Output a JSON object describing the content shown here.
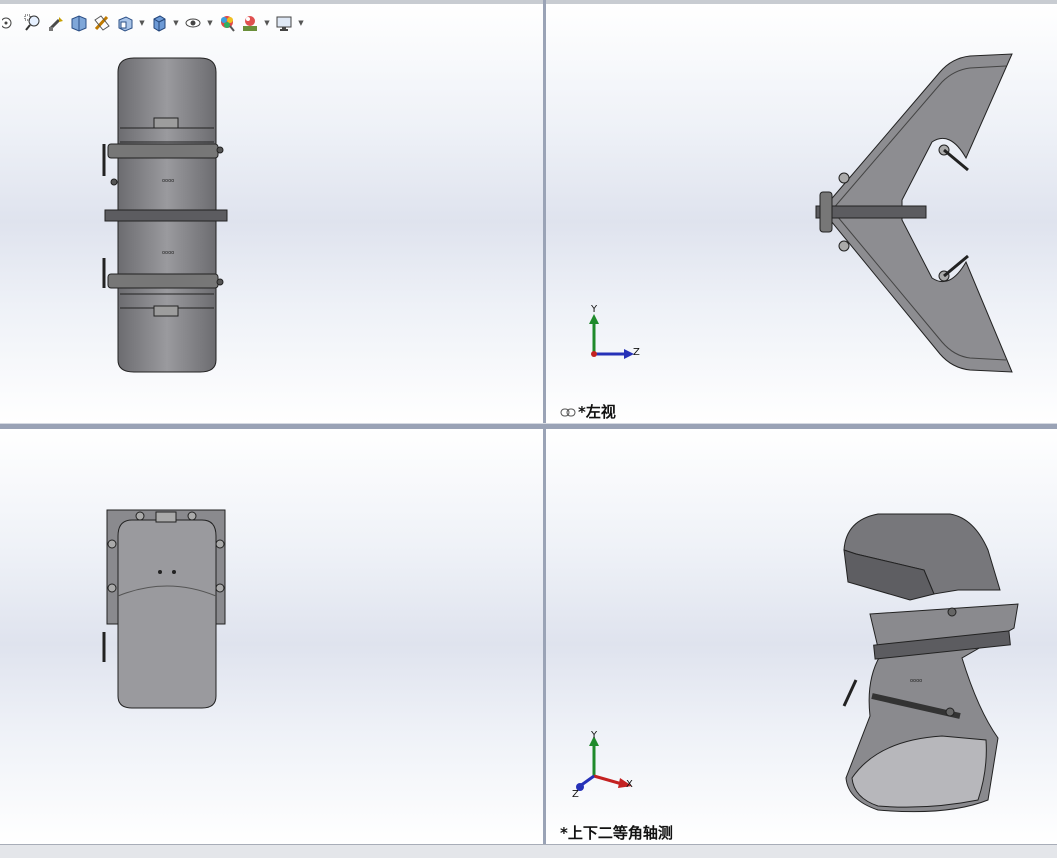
{
  "toolbar": {
    "buttons": [
      "zoom-to-fit-icon",
      "zoom-area-icon",
      "previous-view-icon",
      "section-view-icon",
      "dynamic-annotation-icon",
      "view-orientation-icon",
      "display-style-icon",
      "hide-show-items-icon",
      "edit-appearance-icon",
      "apply-scene-icon",
      "view-settings-icon"
    ]
  },
  "viewports": {
    "top_left": {
      "label": ""
    },
    "top_right": {
      "label": "*左视",
      "triad": {
        "y": "Y",
        "z": "Z"
      }
    },
    "bottom_left": {
      "label": ""
    },
    "bottom_right": {
      "label": "*上下二等角轴测",
      "triad": {
        "x": "X",
        "y": "Y",
        "z": "Z"
      }
    }
  },
  "colors": {
    "model_fill": "#8d8d91",
    "model_dark": "#5c5c60",
    "model_edge": "#2a2a2a",
    "axis_y": "#1f8a2b",
    "axis_z": "#2631b8",
    "axis_x": "#c42121"
  }
}
